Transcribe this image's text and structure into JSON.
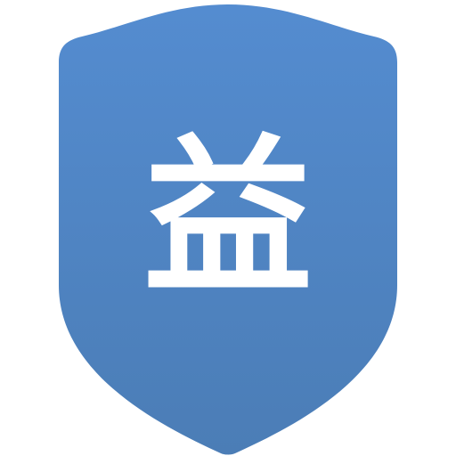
{
  "icon": {
    "name": "shield-icon",
    "glyph": "益",
    "colors": {
      "shield_top": "#548cd0",
      "shield_bottom": "#4b7db6",
      "glyph": "#ffffff",
      "background": "#ffffff"
    }
  }
}
